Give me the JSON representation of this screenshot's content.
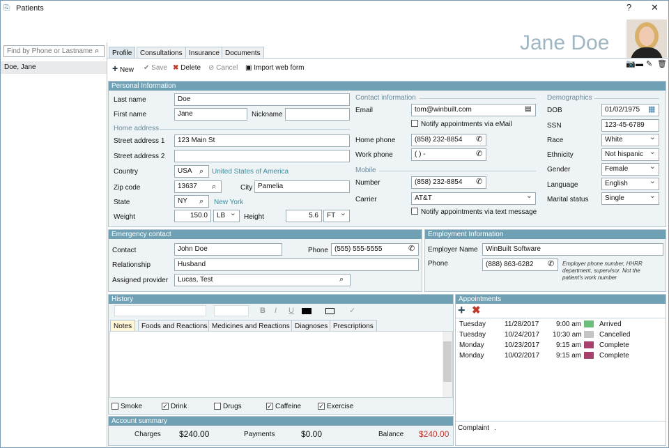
{
  "window": {
    "title": "Patients",
    "help": "?",
    "close": "✕"
  },
  "sidebar": {
    "search_placeholder": "Find by Phone or Lastname",
    "items": [
      "Doe, Jane"
    ]
  },
  "patient": {
    "name": "Jane Doe"
  },
  "tabs": [
    "Profile",
    "Consultations",
    "Insurance",
    "Documents"
  ],
  "toolbar": {
    "new": "New",
    "save": "Save",
    "delete": "Delete",
    "cancel": "Cancel",
    "import": "Import web form"
  },
  "personal": {
    "header": "Personal Information",
    "last_name_label": "Last name",
    "last_name": "Doe",
    "first_name_label": "First name",
    "first_name": "Jane",
    "nickname_label": "Nickname",
    "nickname": "",
    "home_address": "Home address",
    "street1_label": "Street address 1",
    "street1": "123 Main St",
    "street2_label": "Street address 2",
    "street2": "",
    "country_label": "Country",
    "country": "USA",
    "country_name": "United States of America",
    "zip_label": "Zip code",
    "zip": "13637",
    "city_label": "City",
    "city": "Pamelia",
    "state_label": "State",
    "state": "NY",
    "state_name": "New York",
    "weight_label": "Weight",
    "weight": "150.0",
    "weight_unit": "LB",
    "height_label": "Height",
    "height": "5.6",
    "height_unit": "FT"
  },
  "contact": {
    "header": "Contact information",
    "email_label": "Email",
    "email": "tom@winbuilt.com",
    "notify_email": "Notify appointments via eMail",
    "home_phone_label": "Home phone",
    "home_phone": "(858) 232-8854",
    "work_phone_label": "Work phone",
    "work_phone": "(  )   -",
    "mobile": "Mobile",
    "number_label": "Number",
    "number": "(858) 232-8854",
    "carrier_label": "Carrier",
    "carrier": "AT&T",
    "notify_text": "Notify appointments via text message"
  },
  "demographics": {
    "header": "Demographics",
    "dob_label": "DOB",
    "dob": "01/02/1975",
    "ssn_label": "SSN",
    "ssn": "123-45-6789",
    "race_label": "Race",
    "race": "White",
    "ethnicity_label": "Ethnicity",
    "ethnicity": "Not hispanic",
    "gender_label": "Gender",
    "gender": "Female",
    "language_label": "Language",
    "language": "English",
    "marital_label": "Marital status",
    "marital": "Single"
  },
  "emergency": {
    "header": "Emergency contact",
    "contact_label": "Contact",
    "contact": "John Doe",
    "phone_label": "Phone",
    "phone": "(555) 555-5555",
    "relationship_label": "Relationship",
    "relationship": "Husband",
    "provider_label": "Assigned provider",
    "provider": "Lucas, Test"
  },
  "employment": {
    "header": "Employment Information",
    "employer_label": "Employer Name",
    "employer": "WinBuilt Software",
    "phone_label": "Phone",
    "phone": "(888) 863-6282",
    "hint": "Employer phone number, HHRR department, supervisor. Not the patient's work number"
  },
  "history": {
    "header": "History",
    "tabs": [
      "Notes",
      "Foods and Reactions",
      "Medicines and Reactions",
      "Diagnoses",
      "Prescriptions"
    ],
    "checks": [
      {
        "label": "Smoke",
        "checked": false
      },
      {
        "label": "Drink",
        "checked": true
      },
      {
        "label": "Drugs",
        "checked": false
      },
      {
        "label": "Caffeine",
        "checked": true
      },
      {
        "label": "Exercise",
        "checked": true
      }
    ]
  },
  "appointments": {
    "header": "Appointments",
    "rows": [
      {
        "day": "Tuesday",
        "date": "11/28/2017",
        "time": "9:00 am",
        "color": "#6bbf7a",
        "status": "Arrived"
      },
      {
        "day": "Tuesday",
        "date": "10/24/2017",
        "time": "10:30 am",
        "color": "#c4c4c4",
        "status": "Cancelled"
      },
      {
        "day": "Monday",
        "date": "10/23/2017",
        "time": "9:15 am",
        "color": "#a8406e",
        "status": "Complete"
      },
      {
        "day": "Monday",
        "date": "10/02/2017",
        "time": "9:15 am",
        "color": "#a8406e",
        "status": "Complete"
      }
    ],
    "complaint_label": "Complaint",
    "complaint": "."
  },
  "account": {
    "header": "Account summary",
    "charges_label": "Charges",
    "charges": "$240.00",
    "payments_label": "Payments",
    "payments": "$0.00",
    "balance_label": "Balance",
    "balance": "$240.00",
    "balance_color": "#c0392b"
  }
}
